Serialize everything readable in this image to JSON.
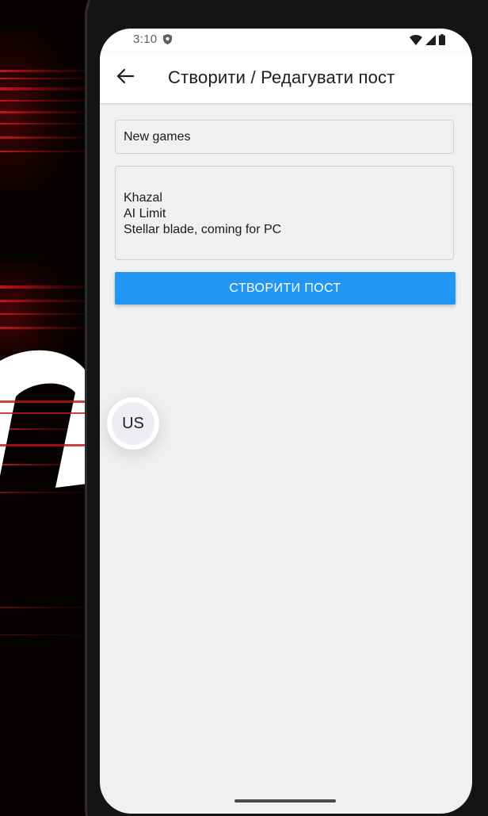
{
  "status_bar": {
    "time": "3:10",
    "icons": [
      "shield-icon",
      "wifi-icon",
      "signal-icon",
      "battery-icon"
    ]
  },
  "app_bar": {
    "back_icon": "arrow-left-icon",
    "title": "Створити / Редагувати пост"
  },
  "form": {
    "title_field": {
      "value": "New games"
    },
    "body_field": {
      "value": "Khazal\nAI Limit\nStellar blade, coming for PC"
    },
    "submit_label": "СТВОРИТИ ПОСТ"
  },
  "floating_avatar": {
    "initials": "US"
  },
  "colors": {
    "accent": "#2296f3",
    "screen_background": "#f0f0f0",
    "app_bar": "#ffffff",
    "wallpaper": "#060101",
    "wallpaper_streak": "#c0141a"
  }
}
